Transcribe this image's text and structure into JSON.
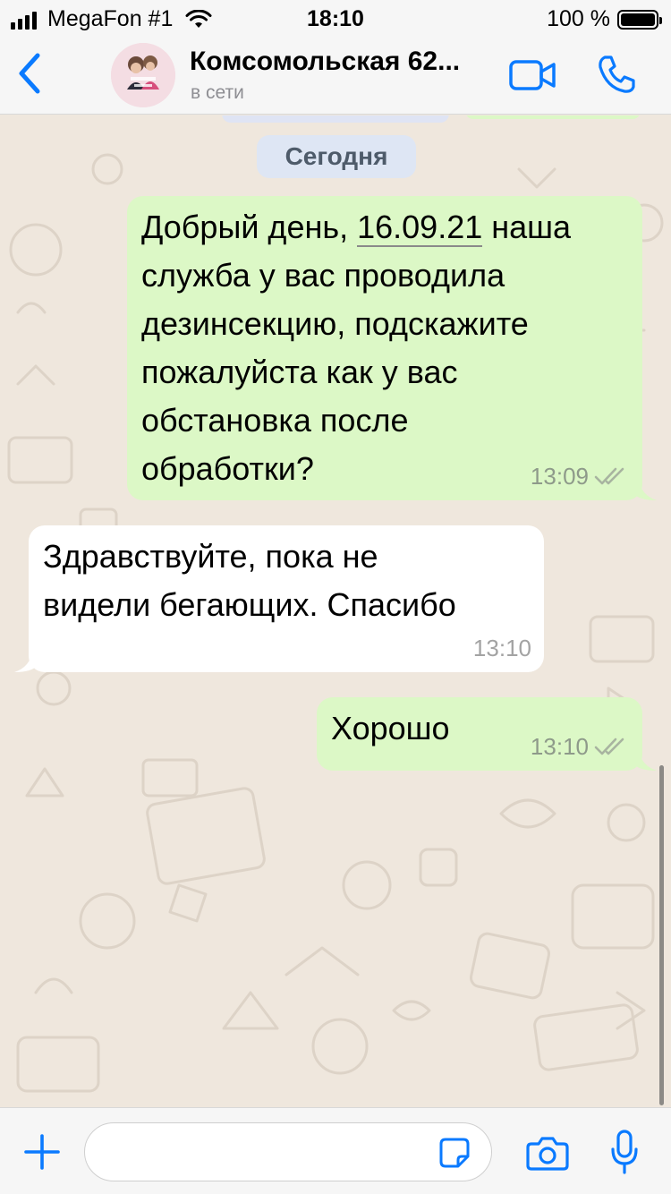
{
  "status_bar": {
    "carrier": "MegaFon #1",
    "time": "18:10",
    "battery_text": "100 %",
    "battery_level": 1.0
  },
  "header": {
    "contact_name": "Комсомольская 62...",
    "contact_status": "в сети"
  },
  "chat": {
    "date_separator": "Сегодня",
    "messages": [
      {
        "direction": "outgoing",
        "lines": [
          "Добрый день, ",
          "16.09.21",
          " наша",
          "служба у вас проводила",
          "дезинсекцию, подскажите",
          "пожалуйста как у вас",
          "обстановка после",
          "обработки?"
        ],
        "time": "13:09",
        "status": "read"
      },
      {
        "direction": "incoming",
        "lines": [
          "Здравствуйте, пока не",
          "видели бегающих. Спасибо"
        ],
        "time": "13:10"
      },
      {
        "direction": "outgoing",
        "lines": [
          "Хорошо"
        ],
        "time": "13:10",
        "status": "read"
      }
    ]
  },
  "input": {
    "value": "",
    "placeholder": ""
  },
  "colors": {
    "accent": "#0a7aff",
    "outgoing_bubble": "#dcf8c6",
    "incoming_bubble": "#ffffff",
    "chat_background": "#efe7dd",
    "date_chip": "#dee6f4"
  },
  "icons": {
    "back": "chevron-left-icon",
    "video": "video-camera-icon",
    "call": "phone-icon",
    "plus": "plus-icon",
    "sticker": "sticker-icon",
    "camera": "camera-icon",
    "mic": "microphone-icon",
    "read": "double-check-icon"
  }
}
